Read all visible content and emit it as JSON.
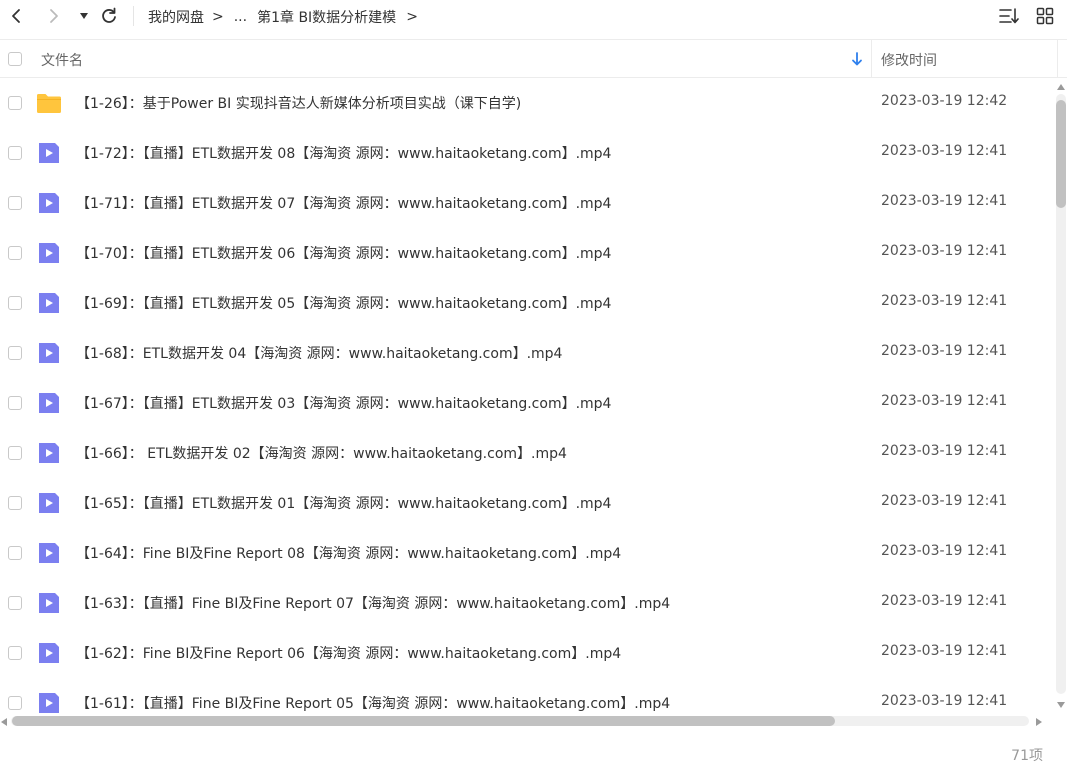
{
  "toolbar": {
    "breadcrumb": {
      "root": "我的网盘",
      "separator": ">",
      "ellipsis": "...",
      "current": "第1章 BI数据分析建模"
    }
  },
  "header": {
    "name_label": "文件名",
    "time_label": "修改时间"
  },
  "files": [
    {
      "name": "【1-26】：基于Power BI 实现抖音达人新媒体分析项目实战（课下自学)",
      "time": "2023-03-19 12:42",
      "type": "folder"
    },
    {
      "name": "【1-72】：【直播】ETL数据开发 08【海淘资 源网：www.haitaoketang.com】.mp4",
      "time": "2023-03-19 12:41",
      "type": "video"
    },
    {
      "name": "【1-71】：【直播】ETL数据开发 07【海淘资 源网：www.haitaoketang.com】.mp4",
      "time": "2023-03-19 12:41",
      "type": "video"
    },
    {
      "name": "【1-70】：【直播】ETL数据开发 06【海淘资 源网：www.haitaoketang.com】.mp4",
      "time": "2023-03-19 12:41",
      "type": "video"
    },
    {
      "name": "【1-69】：【直播】ETL数据开发 05【海淘资 源网：www.haitaoketang.com】.mp4",
      "time": "2023-03-19 12:41",
      "type": "video"
    },
    {
      "name": "【1-68】：ETL数据开发 04【海淘资 源网：www.haitaoketang.com】.mp4",
      "time": "2023-03-19 12:41",
      "type": "video"
    },
    {
      "name": "【1-67】：【直播】ETL数据开发 03【海淘资 源网：www.haitaoketang.com】.mp4",
      "time": "2023-03-19 12:41",
      "type": "video"
    },
    {
      "name": "【1-66】： ETL数据开发 02【海淘资 源网：www.haitaoketang.com】.mp4",
      "time": "2023-03-19 12:41",
      "type": "video"
    },
    {
      "name": "【1-65】：【直播】ETL数据开发 01【海淘资 源网：www.haitaoketang.com】.mp4",
      "time": "2023-03-19 12:41",
      "type": "video"
    },
    {
      "name": "【1-64】：Fine BI及Fine Report 08【海淘资 源网：www.haitaoketang.com】.mp4",
      "time": "2023-03-19 12:41",
      "type": "video"
    },
    {
      "name": "【1-63】：【直播】Fine BI及Fine Report 07【海淘资 源网：www.haitaoketang.com】.mp4",
      "time": "2023-03-19 12:41",
      "type": "video"
    },
    {
      "name": "【1-62】：Fine BI及Fine Report 06【海淘资 源网：www.haitaoketang.com】.mp4",
      "time": "2023-03-19 12:41",
      "type": "video"
    },
    {
      "name": "【1-61】：【直播】Fine BI及Fine Report 05【海淘资 源网：www.haitaoketang.com】.mp4",
      "time": "2023-03-19 12:41",
      "type": "video"
    }
  ],
  "footer": {
    "item_count": "71项"
  },
  "colors": {
    "folder": "#FFC53D",
    "video": "#7B7FF0",
    "accent": "#2F80ED"
  }
}
